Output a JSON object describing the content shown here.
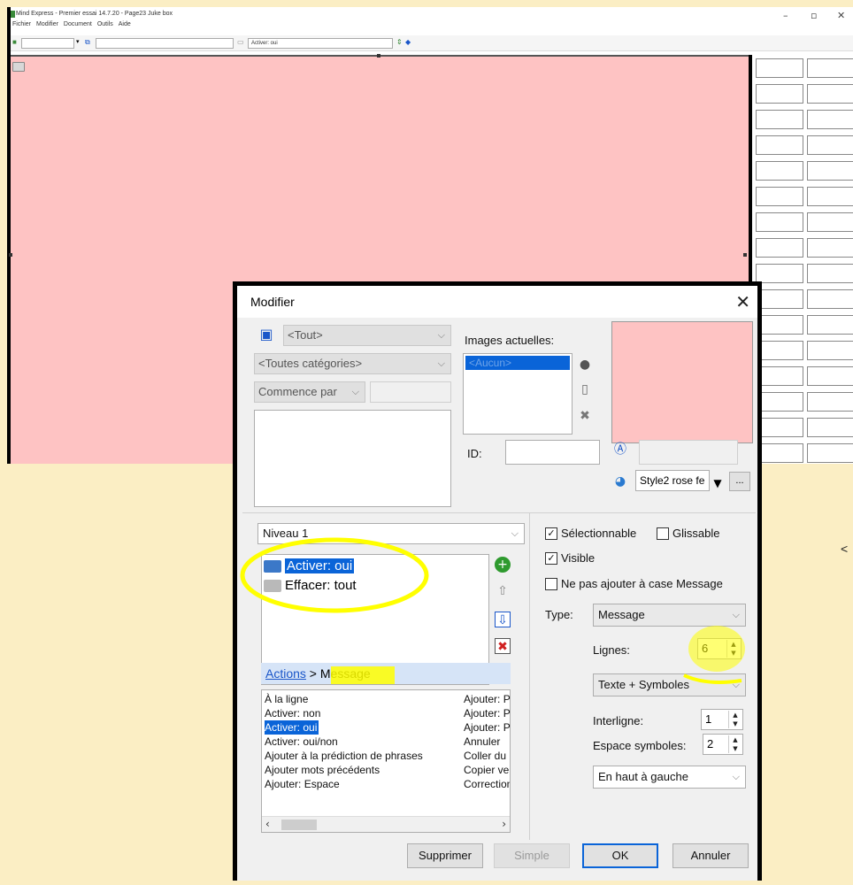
{
  "main_window": {
    "title": "Mind Express - Premier essai 14.7.20 - Page23 Juke box",
    "window_controls": {
      "minimize": "–",
      "maximize": "▫",
      "close": "✕"
    },
    "menu": [
      "Fichier",
      "Modifier",
      "Document",
      "Outils",
      "Aide"
    ],
    "toolbar": {
      "action_field": "Activer: oui"
    }
  },
  "dialog": {
    "title": "Modifier",
    "close_glyph": "✕",
    "filter_all": "<Tout>",
    "filter_categories": "<Toutes catégories>",
    "filter_match": "Commence par",
    "images_label": "Images actuelles:",
    "images_selected": "<Aucun>",
    "id_label": "ID:",
    "id_value": "",
    "style_value": "Style2 rose fe",
    "style_more": "...",
    "level_value": "Niveau 1",
    "actions": [
      {
        "label": "Activer: oui",
        "selected": true
      },
      {
        "label": "Effacer: tout",
        "selected": false
      }
    ],
    "breadcrumb": {
      "root": "Actions",
      "separator": " > ",
      "current": "Message"
    },
    "commands_left": [
      "À la ligne",
      "Activer: non",
      "Activer: oui",
      "Activer: oui/non",
      "Ajouter à la prédiction de phrases",
      "Ajouter mots précédents",
      "Ajouter: Espace"
    ],
    "commands_selected_index": 2,
    "commands_right": [
      "Ajouter: P",
      "Ajouter: P",
      "Ajouter: P",
      "Annuler",
      "Coller du p",
      "Copier ver",
      "Correction"
    ],
    "options": {
      "selectable": {
        "label": "Sélectionnable",
        "checked": true
      },
      "draggable": {
        "label": "Glissable",
        "checked": false
      },
      "visible": {
        "label": "Visible",
        "checked": true
      },
      "no_message": {
        "label": "Ne pas ajouter à case Message",
        "checked": false
      }
    },
    "type_label": "Type:",
    "type_value": "Message",
    "lines_label": "Lignes:",
    "lines_value": "6",
    "display_value": "Texte + Symboles",
    "line_spacing_label": "Interligne:",
    "line_spacing_value": "1",
    "symbol_spacing_label": "Espace symboles:",
    "symbol_spacing_value": "2",
    "alignment_value": "En haut à gauche",
    "buttons": {
      "delete": "Supprimer",
      "simple": "Simple",
      "ok": "OK",
      "cancel": "Annuler"
    }
  },
  "colors": {
    "cell_pink": "#fec3c3",
    "background": "#fbeec4",
    "selection": "#0a64d8",
    "highlight": "#ffff00"
  },
  "side_arrow": "<"
}
